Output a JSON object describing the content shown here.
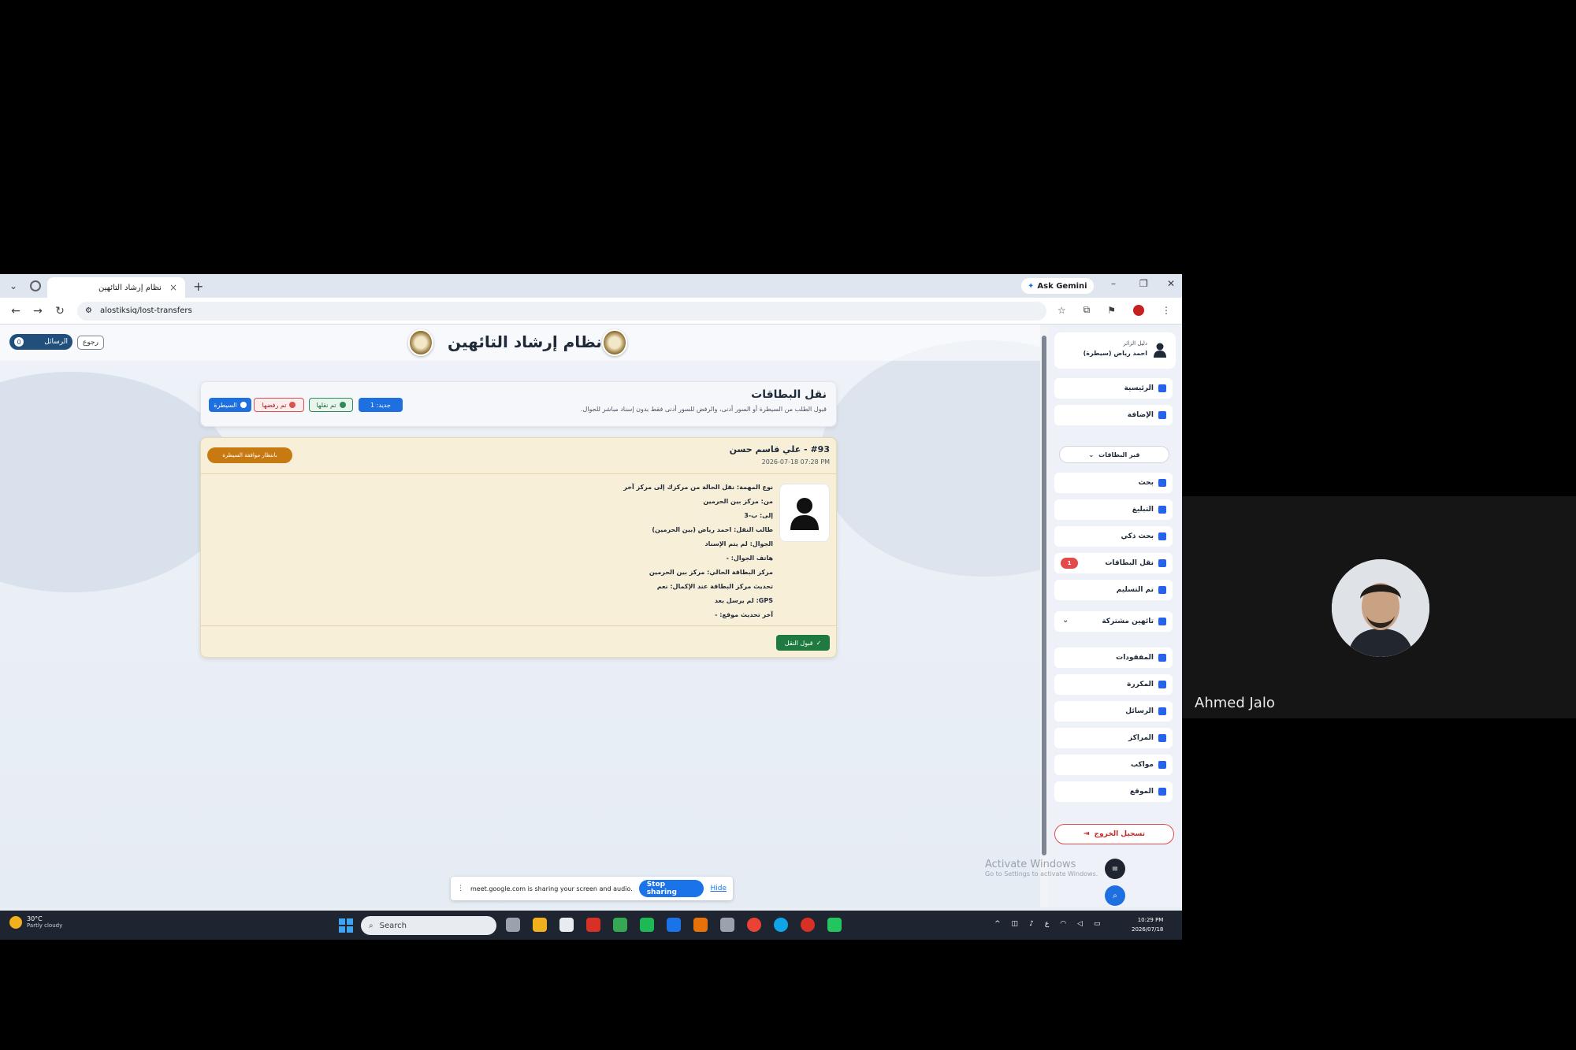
{
  "browser": {
    "tab_title": "نظام إرشاد التائهين",
    "tab_close": "×",
    "new_tab": "+",
    "ask_gemini": "Ask Gemini",
    "url": "alostiksiq/lost-transfers"
  },
  "header": {
    "title": "نظام إرشاد التائهين",
    "back_label": "رجوع",
    "messages_label": "الرسائل",
    "messages_count": "0"
  },
  "transfers": {
    "title": "نقل البطاقات",
    "subtitle": "قبول الطلب من السيطرة أو السور أدنى، والرفض للسور أدنى فقط بدون إسناد مباشر للجوال.",
    "chip_new": "جديد: 1",
    "chip_accepted": "تم نقلها",
    "chip_rejected": "تم رفضها",
    "chip_all": "السيطرة"
  },
  "transfer_card": {
    "title": "#93 - علي قاسم حسن",
    "time": "2026-07-18 07:28 PM",
    "status": "بانتظار موافقة السيطرة",
    "details": [
      "نوع المهمة: نقل الحالة من مركزك إلى مركز آخر",
      "من: مركز بين الحرمين",
      "إلى: ب-3",
      "طالب النقل: احمد رياض (بين الحرمين)",
      "الجوال: لم يتم الإسناد",
      "هاتف الجوال: -",
      "مركز البطاقة الحالي: مركز بين الحرمين",
      "تحديث مركز البطاقة عند الإكمال: نعم",
      "GPS: لم يرسل بعد",
      "آخر تحديث موقع: -"
    ],
    "accept_label": "قبول النقل"
  },
  "sidebar": {
    "user_role": "دليل الزائر",
    "user_name": "احمد رياض (سيطرة)",
    "items": [
      {
        "label": "الرئيسية",
        "color": "#2563eb"
      },
      {
        "label": "الإضافة",
        "color": "#2563eb"
      },
      {
        "label": "بحث",
        "color": "#2563eb"
      },
      {
        "label": "التبليغ",
        "color": "#2563eb"
      },
      {
        "label": "بحث ذكي",
        "color": "#2563eb"
      },
      {
        "label": "نقل البطاقات",
        "color": "#2563eb",
        "count": "1"
      },
      {
        "label": "تم التسليم",
        "color": "#2563eb"
      },
      {
        "label": "تائهين مشتركة",
        "color": "#2563eb"
      },
      {
        "label": "المفقودات",
        "color": "#2563eb"
      },
      {
        "label": "المكررة",
        "color": "#2563eb"
      },
      {
        "label": "الرسائل",
        "color": "#2563eb"
      },
      {
        "label": "المراكز",
        "color": "#2563eb"
      },
      {
        "label": "مواكب",
        "color": "#2563eb"
      },
      {
        "label": "الموقع",
        "color": "#2563eb"
      }
    ],
    "cards_select": "قبر البطاقات",
    "logout": "تسجيل الخروج"
  },
  "watermark": {
    "line1": "Activate Windows",
    "line2": "Go to Settings to activate Windows."
  },
  "share_bar": {
    "message": "meet.google.com is sharing your screen and audio.",
    "stop": "Stop sharing",
    "hide": "Hide"
  },
  "taskbar": {
    "temp": "30°C",
    "weather": "Partly cloudy",
    "search_placeholder": "Search",
    "time": "10:29 PM",
    "date": "2026/07/18"
  },
  "participant": {
    "name": "Ahmed Jalo"
  }
}
